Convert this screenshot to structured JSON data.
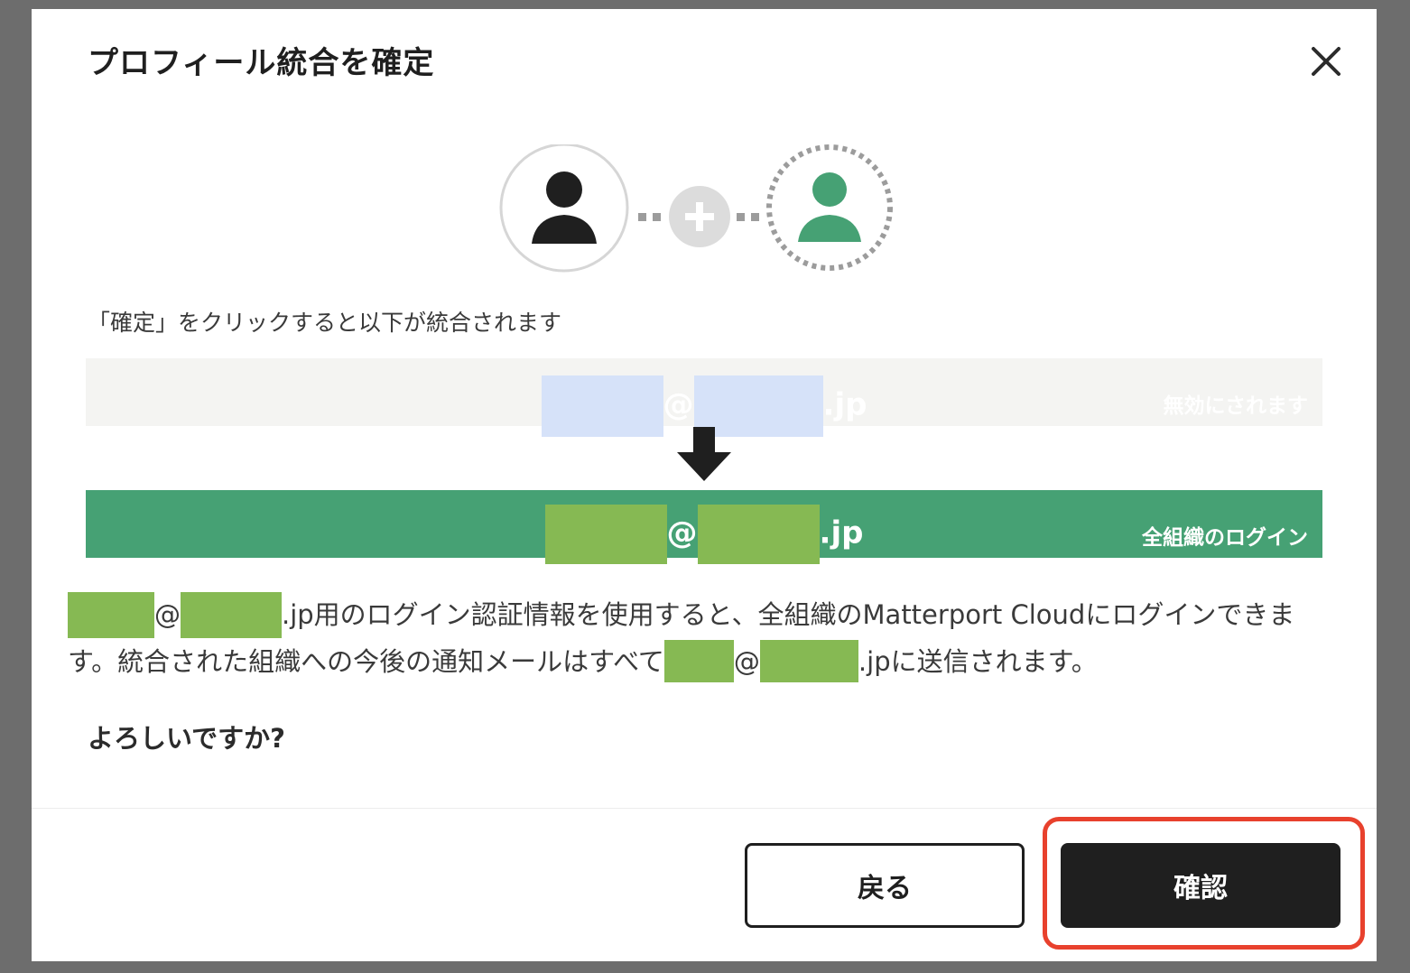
{
  "modal": {
    "title": "プロフィール統合を確定",
    "intro": "「確定」をクリックすると以下が統合されます",
    "source": {
      "at": "@",
      "domain_suffix": ".jp",
      "tag": "無効にされます"
    },
    "target": {
      "at": "@",
      "domain_suffix": ".jp",
      "tag": "全組織のログイン"
    },
    "description": {
      "at1": "@",
      "part1": ".jp用のログイン認証情報を使用すると、全組織のMatterport Cloudにログインできます。統合された組織への今後の通知メールはすべて",
      "at2": "@",
      "part2": ".jpに送信されます。"
    },
    "question": "よろしいですか?",
    "buttons": {
      "back": "戻る",
      "confirm": "確認"
    }
  },
  "colors": {
    "accent_green": "#46a174",
    "button_dark": "#1f1f1f",
    "highlight_red": "#e8412d"
  },
  "icons": {
    "close": "close-icon",
    "user": "user-icon",
    "plus": "plus-icon",
    "arrow": "arrow-down-icon"
  }
}
